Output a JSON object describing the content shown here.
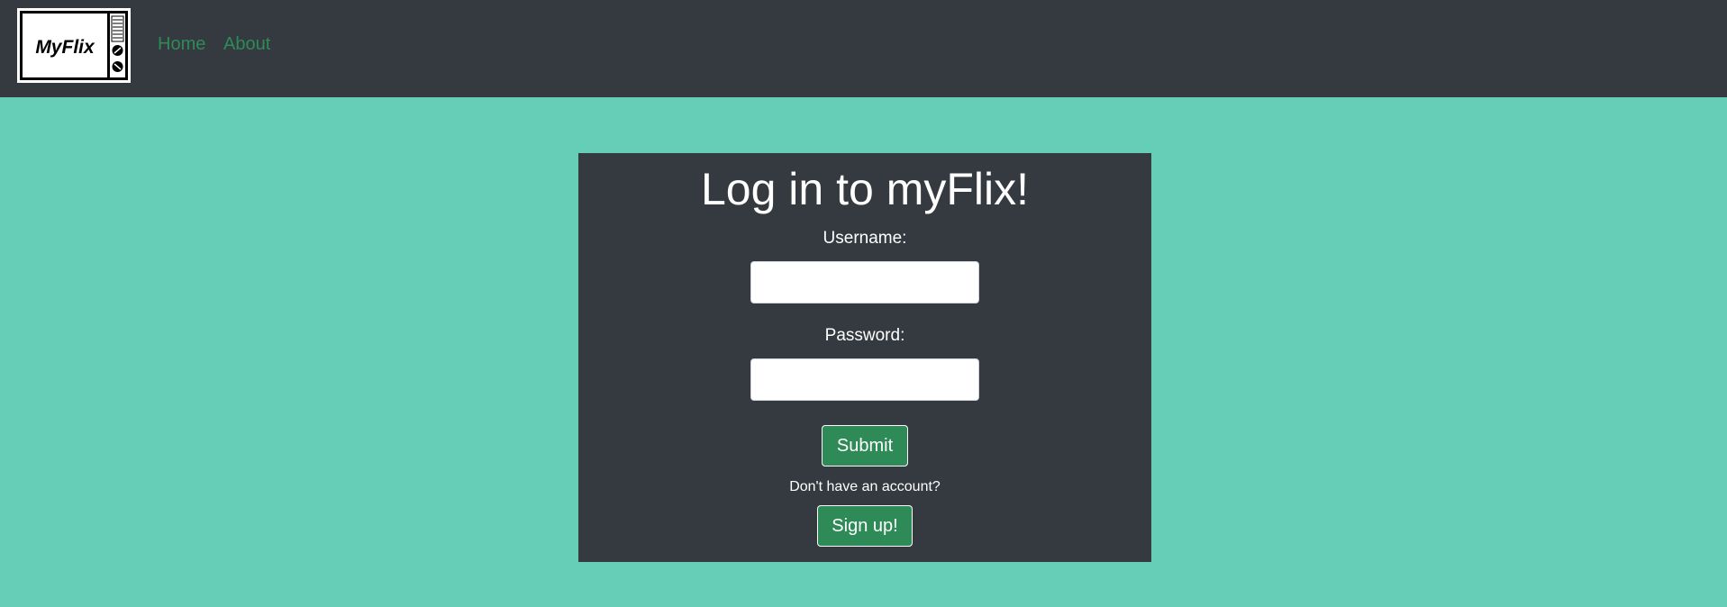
{
  "navbar": {
    "logo_text": "MyFlix",
    "links": [
      {
        "label": "Home"
      },
      {
        "label": "About"
      }
    ],
    "link_color": "#2e8b57",
    "background": "#343a40"
  },
  "login": {
    "title": "Log in to myFlix!",
    "username_label": "Username:",
    "username_value": "",
    "password_label": "Password:",
    "password_value": "",
    "submit_label": "Submit",
    "signup_prompt": "Don't have an account?",
    "signup_label": "Sign up!"
  },
  "colors": {
    "page_background": "#66cdb6",
    "card_background": "#343a40",
    "button_green": "#2e8b57"
  }
}
